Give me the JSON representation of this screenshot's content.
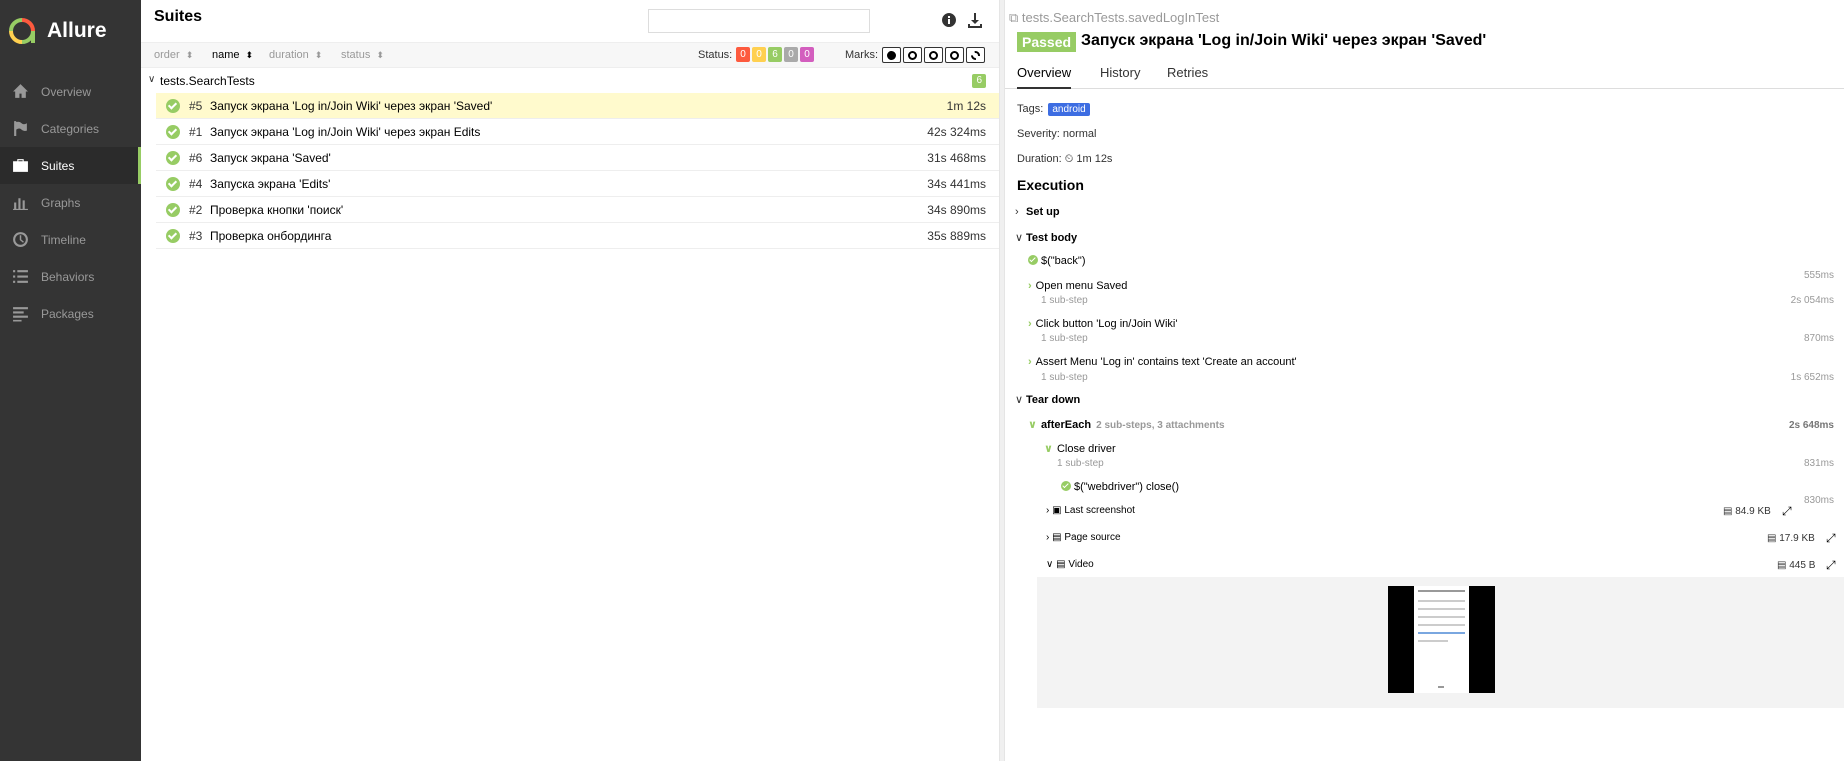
{
  "app": {
    "name": "Allure"
  },
  "sidebar": {
    "items": [
      {
        "label": "Overview",
        "icon": "home-icon",
        "active": false
      },
      {
        "label": "Categories",
        "icon": "flag-icon",
        "active": false
      },
      {
        "label": "Suites",
        "icon": "briefcase-icon",
        "active": true
      },
      {
        "label": "Graphs",
        "icon": "bar-chart-icon",
        "active": false
      },
      {
        "label": "Timeline",
        "icon": "clock-icon",
        "active": false
      },
      {
        "label": "Behaviors",
        "icon": "list-icon",
        "active": false
      },
      {
        "label": "Packages",
        "icon": "align-left-icon",
        "active": false
      }
    ]
  },
  "suites": {
    "title": "Suites",
    "search": {
      "value": "",
      "placeholder": ""
    },
    "sort": {
      "order": "order",
      "name": "name",
      "duration": "duration",
      "status": "status"
    },
    "status_label": "Status:",
    "status_counts": [
      {
        "value": "0",
        "color": "#fd5a3e"
      },
      {
        "value": "0",
        "color": "#ffd050"
      },
      {
        "value": "6",
        "color": "#97cc64"
      },
      {
        "value": "0",
        "color": "#aaaaaa"
      },
      {
        "value": "0",
        "color": "#d35ebe"
      }
    ],
    "marks_label": "Marks:",
    "group": {
      "name": "tests.SearchTests",
      "count": "6"
    },
    "tests": [
      {
        "num": "#5",
        "name": "Запуск экрана 'Log in/Join Wiki' через экран 'Saved'",
        "duration": "1m 12s",
        "selected": true
      },
      {
        "num": "#1",
        "name": "Запуск экрана 'Log in/Join Wiki' через экран Edits",
        "duration": "42s 324ms",
        "selected": false
      },
      {
        "num": "#6",
        "name": "Запуск экрана 'Saved'",
        "duration": "31s 468ms",
        "selected": false
      },
      {
        "num": "#4",
        "name": "Запуска экрана 'Edits'",
        "duration": "34s 441ms",
        "selected": false
      },
      {
        "num": "#2",
        "name": "Проверка кнопки 'поиск'",
        "duration": "34s 890ms",
        "selected": false
      },
      {
        "num": "#3",
        "name": "Проверка онбординга",
        "duration": "35s 889ms",
        "selected": false
      }
    ]
  },
  "detail": {
    "breadcrumb": "tests.SearchTests.savedLogInTest",
    "status": "Passed",
    "title": "Запуск экрана 'Log in/Join Wiki' через экран 'Saved'",
    "tabs": [
      "Overview",
      "History",
      "Retries"
    ],
    "tags_label": "Tags:",
    "tag": "android",
    "severity": "Severity: normal",
    "duration_label": "Duration:",
    "duration": "1m 12s",
    "execution": "Execution",
    "setup": "Set up",
    "test_body": "Test body",
    "steps": [
      {
        "name": "$(\"back\")",
        "sub": "",
        "duration": "555ms"
      },
      {
        "name": "Open menu Saved",
        "sub": "1 sub-step",
        "duration": "2s 054ms"
      },
      {
        "name": "Click button 'Log in/Join Wiki'",
        "sub": "1 sub-step",
        "duration": "870ms"
      },
      {
        "name": "Assert Menu 'Log in' contains text 'Create an account'",
        "sub": "1 sub-step",
        "duration": "1s 652ms"
      }
    ],
    "tear_down": "Tear down",
    "after_each": {
      "name": "afterEach",
      "meta": "2 sub-steps, 3 attachments",
      "duration": "2s 648ms"
    },
    "close_driver": {
      "name": "Close driver",
      "sub": "1 sub-step",
      "duration": "831ms"
    },
    "webdriver_close": {
      "name": "$(\"webdriver\") close()",
      "duration": "830ms"
    },
    "attachments": [
      {
        "name": "Last screenshot",
        "size": "84.9 KB"
      },
      {
        "name": "Page source",
        "size": "17.9 KB"
      },
      {
        "name": "Video",
        "size": "445 B"
      }
    ]
  }
}
